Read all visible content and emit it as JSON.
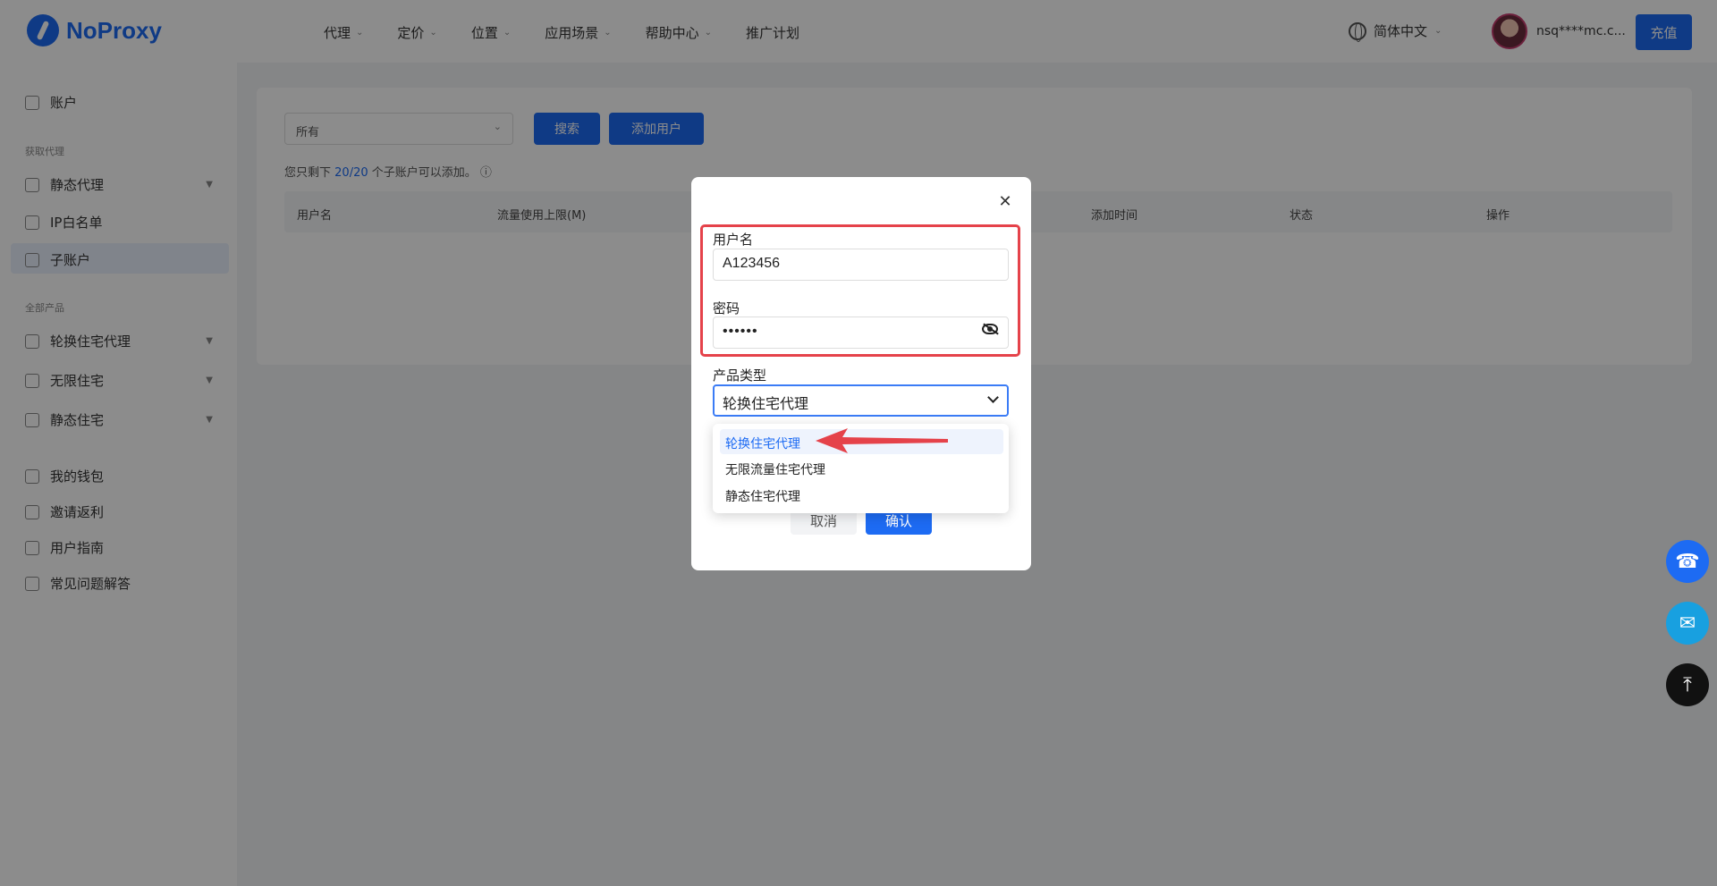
{
  "header": {
    "logo_text": "NoProxy",
    "nav": [
      {
        "label": "代理"
      },
      {
        "label": "定价"
      },
      {
        "label": "位置"
      },
      {
        "label": "应用场景"
      },
      {
        "label": "帮助中心"
      },
      {
        "label": "推广计划"
      }
    ],
    "language": "简体中文",
    "user_name": "nsq****mc.c...",
    "top_button": "充值"
  },
  "sidebar": {
    "items": [
      {
        "label": "账户"
      },
      {
        "label": "静态代理"
      },
      {
        "label": "IP白名单"
      },
      {
        "label": "子账户"
      },
      {
        "label": "轮换住宅代理"
      },
      {
        "label": "无限住宅"
      },
      {
        "label": "静态住宅"
      },
      {
        "label": "我的钱包"
      },
      {
        "label": "邀请返利"
      },
      {
        "label": "用户指南"
      },
      {
        "label": "常见问题解答"
      }
    ],
    "sections": [
      "获取代理",
      "全部产品"
    ]
  },
  "main": {
    "filter_value": "所有",
    "search_button": "搜索",
    "add_user_button": "添加用户",
    "note_prefix": "您只剩下",
    "note_count": "20/20",
    "note_suffix": "个子账户可以添加。",
    "table_columns": [
      "用户名",
      "流量使用上限(M)",
      "添加时间",
      "状态",
      "操作"
    ]
  },
  "modal": {
    "username_label": "用户名",
    "username_value": "A123456",
    "password_label": "密码",
    "password_value": "••••••",
    "product_type_label": "产品类型",
    "product_type_value": "轮换住宅代理",
    "options": [
      {
        "label": "轮换住宅代理",
        "selected": true
      },
      {
        "label": "无限流量住宅代理",
        "selected": false
      },
      {
        "label": "静态住宅代理",
        "selected": false
      }
    ],
    "cancel_label": "取消",
    "confirm_label": "确认"
  },
  "colors": {
    "accent": "#1d6bf3",
    "highlight_box": "#e5424a"
  }
}
